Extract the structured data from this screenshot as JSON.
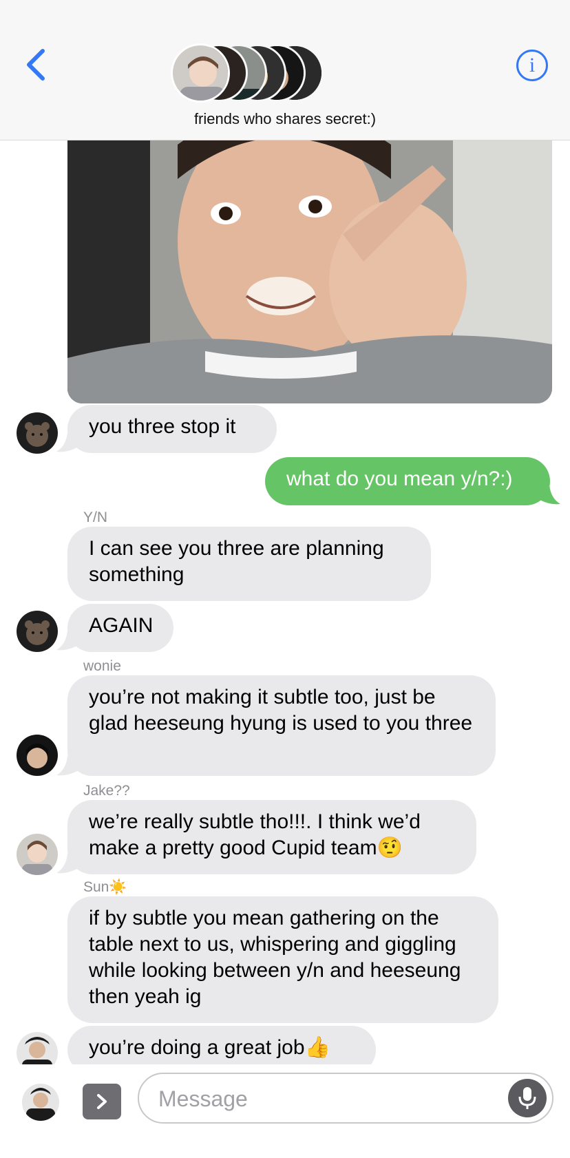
{
  "header": {
    "title": "friends who shares secret:)",
    "back_icon": "chevron-left-icon",
    "info_icon": "info-icon",
    "info_label": "i",
    "accent_color": "#3478f6"
  },
  "messages": [
    {
      "type": "incoming",
      "text": "you three stop it"
    },
    {
      "type": "outgoing",
      "text": "what do you mean y/n?:)"
    },
    {
      "type": "incoming",
      "sender": "Y/N",
      "text": "I can see you three are planning something"
    },
    {
      "type": "incoming",
      "text": "AGAIN"
    },
    {
      "type": "incoming",
      "sender": "wonie",
      "text": "you’re not making it subtle too, just be glad heeseung hyung is used to you three"
    },
    {
      "type": "incoming",
      "sender": "Jake??",
      "text": "we’re really subtle tho!!!. I think we’d make a pretty good Cupid team🤨"
    },
    {
      "type": "incoming",
      "sender": "Sun☀️",
      "text": "if by subtle you mean gathering on the table next to us, whispering and giggling while looking between y/n and heeseung then yeah ig"
    },
    {
      "type": "incoming",
      "text": "you’re doing a great job👍"
    }
  ],
  "composer": {
    "placeholder": "Message",
    "expand_icon": "chevron-right-icon",
    "mic_icon": "microphone-icon"
  },
  "colors": {
    "incoming_bubble": "#e9e9eb",
    "outgoing_bubble": "#65c466",
    "sender_label": "#8e8e93"
  }
}
